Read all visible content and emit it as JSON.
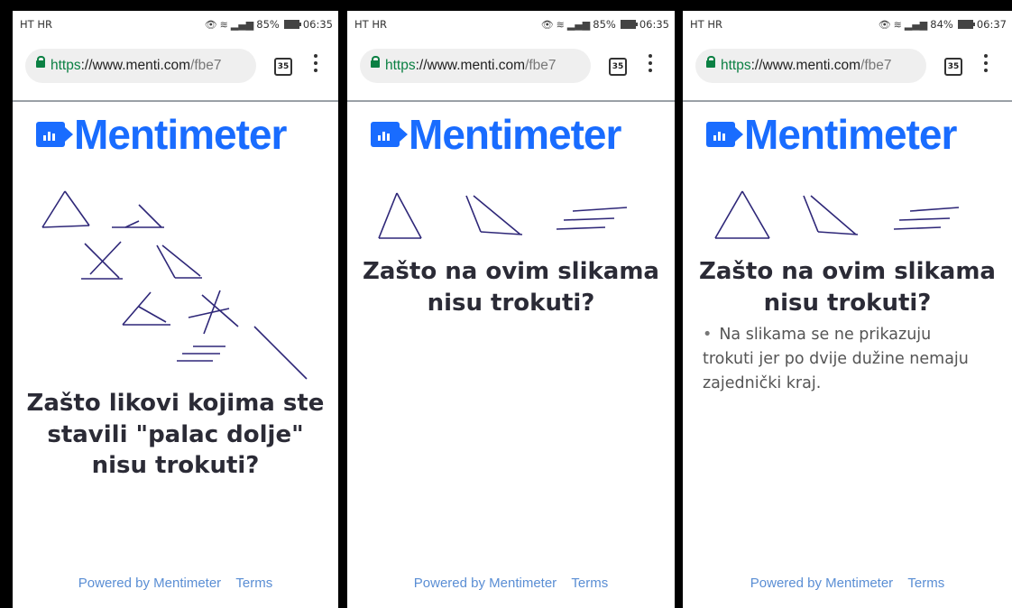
{
  "panels": [
    {
      "status": {
        "carrier": "HT HR",
        "battery": "85%",
        "time": "06:35"
      },
      "url": {
        "scheme": "https",
        "host": "://www.menti.com",
        "path": "/fbe7"
      },
      "tab_count": "35",
      "logo": "Mentimeter",
      "question": [
        "Zašto likovi kojima ste",
        "stavili \"palac dolje\"",
        "nisu trokuti?"
      ],
      "footer": {
        "powered": "Powered by Mentimeter",
        "terms": "Terms"
      }
    },
    {
      "status": {
        "carrier": "HT HR",
        "battery": "85%",
        "time": "06:35"
      },
      "url": {
        "scheme": "https",
        "host": "://www.menti.com",
        "path": "/fbe7"
      },
      "tab_count": "35",
      "logo": "Mentimeter",
      "question": [
        "Zašto na ovim slikama",
        "nisu trokuti?"
      ],
      "footer": {
        "powered": "Powered by Mentimeter",
        "terms": "Terms"
      }
    },
    {
      "status": {
        "carrier": "HT HR",
        "battery": "84%",
        "time": "06:37"
      },
      "url": {
        "scheme": "https",
        "host": "://www.menti.com",
        "path": "/fbe7"
      },
      "tab_count": "35",
      "logo": "Mentimeter",
      "question": [
        "Zašto na ovim slikama",
        "nisu trokuti?"
      ],
      "answer": [
        "Na slikama se ne prikazuju",
        "trokuti jer po dvije dužine nemaju",
        "zajednički kraj."
      ],
      "footer": {
        "powered": "Powered by Mentimeter",
        "terms": "Terms"
      }
    }
  ],
  "colors": {
    "brand": "#196cff",
    "link": "#5a8ed4",
    "stroke": "#2e2778",
    "secure": "#0b8043"
  },
  "icons": [
    "eye-icon",
    "wifi-icon",
    "signal-icon",
    "battery-icon",
    "lock-icon",
    "tabs-icon",
    "menu-icon",
    "logo-icon"
  ]
}
